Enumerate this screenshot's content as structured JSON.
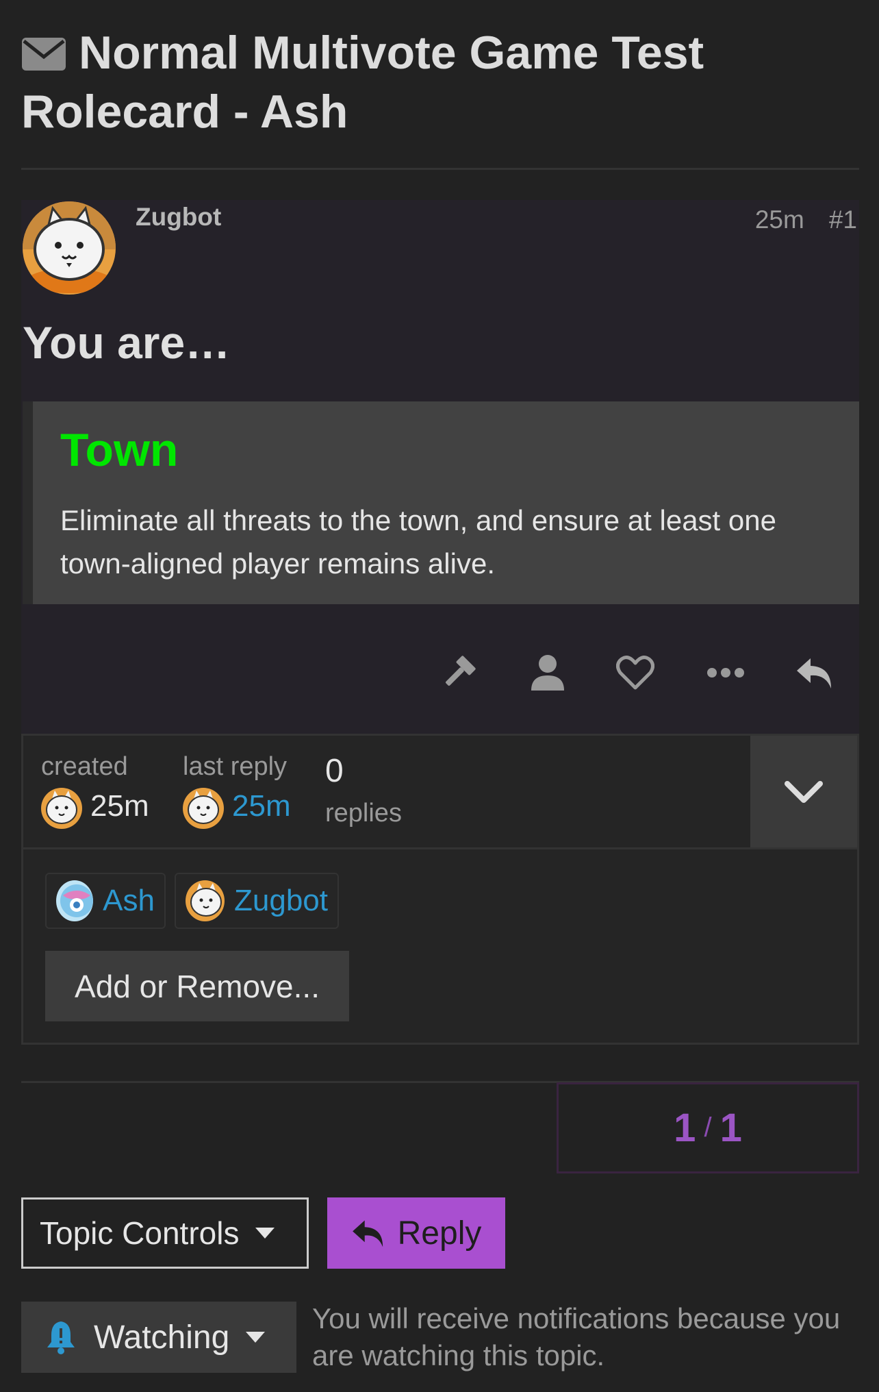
{
  "topic": {
    "title": "Normal Multivote Game Test Rolecard - Ash",
    "title_icon": "envelope-icon"
  },
  "post": {
    "username": "Zugbot",
    "age": "25m",
    "number": "#1",
    "heading": "You are…",
    "quote": {
      "alignment": "Town",
      "alignment_color": "#00e600",
      "text": "Eliminate all threats to the town, and ensure at least one town-aligned player remains alive."
    },
    "actions": [
      "gavel-icon",
      "user-icon",
      "heart-icon",
      "more-icon",
      "reply-icon"
    ]
  },
  "topic_map": {
    "created_label": "created",
    "created_value": "25m",
    "last_reply_label": "last reply",
    "last_reply_value": "25m",
    "replies_count": "0",
    "replies_label": "replies",
    "participants": [
      {
        "name": "Ash"
      },
      {
        "name": "Zugbot"
      }
    ],
    "add_remove_label": "Add or Remove..."
  },
  "pager": {
    "current": "1",
    "separator": "/",
    "total": "1"
  },
  "footer": {
    "topic_controls_label": "Topic Controls",
    "reply_label": "Reply",
    "watching_label": "Watching",
    "watching_note": "You will receive notifications because you are watching this topic."
  },
  "colors": {
    "accent": "#a94fd0",
    "link": "#2d98d0",
    "background": "#222222"
  }
}
